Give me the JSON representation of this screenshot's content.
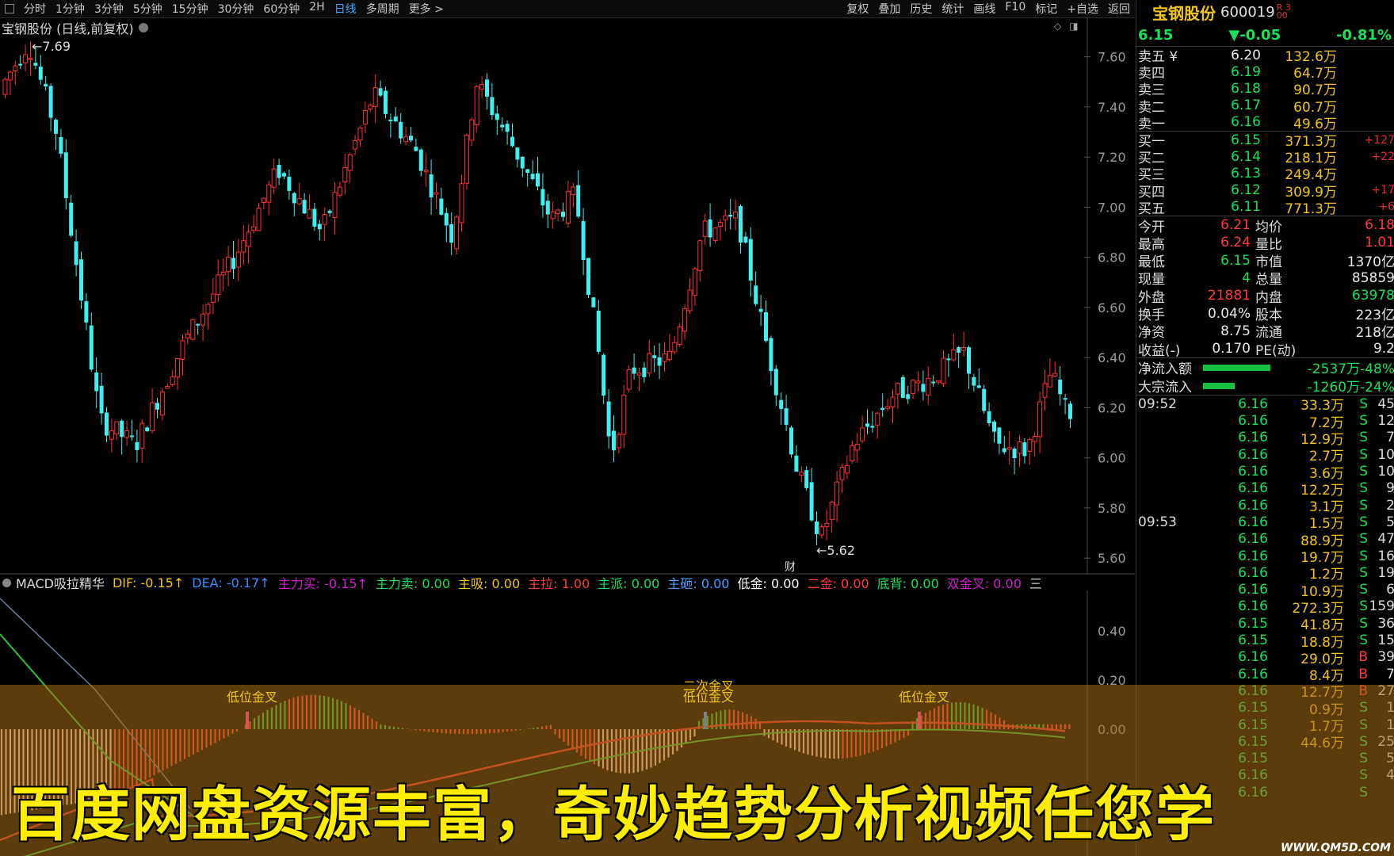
{
  "toolbar": {
    "periods": [
      "分时",
      "1分钟",
      "3分钟",
      "5分钟",
      "15分钟",
      "30分钟",
      "60分钟",
      "2H",
      "日线",
      "多周期",
      "更多 >"
    ],
    "active": "日线",
    "tools": [
      "复权",
      "叠加",
      "历史",
      "统计",
      "画线",
      "F10",
      "标记",
      "+自选",
      "返回"
    ]
  },
  "chart_header": {
    "title": "宝钢股份 (日线,前复权)"
  },
  "price_chart": {
    "high_label": "7.69",
    "low_label": "5.62",
    "marker_cai": "财",
    "axis_ticks": [
      "7.60",
      "7.40",
      "7.20",
      "7.00",
      "6.80",
      "6.60",
      "6.40",
      "6.20",
      "6.00",
      "5.80",
      "5.60"
    ],
    "colors": {
      "up": "#ff3030",
      "down": "#40f0f0"
    }
  },
  "macd_header": [
    {
      "t": "MACD吸拉精华",
      "c": "#dcdcdc"
    },
    {
      "t": "DIF: -0.15↑",
      "c": "#f0c419"
    },
    {
      "t": "DEA: -0.17↑",
      "c": "#3090ff"
    },
    {
      "t": "主力买: -0.15↑",
      "c": "#d020d0"
    },
    {
      "t": "主力卖: 0.00",
      "c": "#18e05a"
    },
    {
      "t": "主吸: 0.00",
      "c": "#f0c419"
    },
    {
      "t": "主拉: 1.00",
      "c": "#ff3b3b"
    },
    {
      "t": "主派: 0.00",
      "c": "#18e05a"
    },
    {
      "t": "主砸: 0.00",
      "c": "#40a0ff"
    },
    {
      "t": "低金: 0.00",
      "c": "#ffffff"
    },
    {
      "t": "二金: 0.00",
      "c": "#ff3b3b"
    },
    {
      "t": "底背: 0.00",
      "c": "#18e05a"
    },
    {
      "t": "双金叉: 0.00",
      "c": "#d020d0"
    }
  ],
  "macd_axis": [
    "0.40",
    "0.20",
    "0.00"
  ],
  "signals": {
    "low1": "低位金叉",
    "second": "二次金叉",
    "low2": "低位金叉",
    "low3": "低位金叉"
  },
  "quote": {
    "name": "宝钢股份",
    "code": "600019",
    "tag": "R 300",
    "price": "6.15",
    "change": "▼-0.05",
    "pct": "-0.81%",
    "asks": [
      {
        "l": "卖五 ¥",
        "p": "6.20",
        "v": "132.6万",
        "x": ""
      },
      {
        "l": "卖四",
        "p": "6.19",
        "v": "64.7万",
        "x": ""
      },
      {
        "l": "卖三",
        "p": "6.18",
        "v": "90.7万",
        "x": ""
      },
      {
        "l": "卖二",
        "p": "6.17",
        "v": "60.7万",
        "x": ""
      },
      {
        "l": "卖一",
        "p": "6.16",
        "v": "49.6万",
        "x": ""
      }
    ],
    "bids": [
      {
        "l": "买一",
        "p": "6.15",
        "v": "371.3万",
        "x": "+127"
      },
      {
        "l": "买二",
        "p": "6.14",
        "v": "218.1万",
        "x": "+22"
      },
      {
        "l": "买三",
        "p": "6.13",
        "v": "249.4万",
        "x": ""
      },
      {
        "l": "买四",
        "p": "6.12",
        "v": "309.9万",
        "x": "+17"
      },
      {
        "l": "买五",
        "p": "6.11",
        "v": "771.3万",
        "x": "+6"
      }
    ],
    "info": [
      {
        "l": "今开",
        "v": "6.21",
        "vc": "r",
        "l2": "均价",
        "v2": "6.18",
        "v2c": "r"
      },
      {
        "l": "最高",
        "v": "6.24",
        "vc": "r",
        "l2": "量比",
        "v2": "1.01",
        "v2c": "r"
      },
      {
        "l": "最低",
        "v": "6.15",
        "vc": "g",
        "l2": "市值",
        "v2": "1370亿",
        "v2c": "w"
      },
      {
        "l": "现量",
        "v": "4",
        "vc": "g",
        "l2": "总量",
        "v2": "85859",
        "v2c": "w"
      },
      {
        "l": "外盘",
        "v": "21881",
        "vc": "r",
        "l2": "内盘",
        "v2": "63978",
        "v2c": "g"
      },
      {
        "l": "换手",
        "v": "0.04%",
        "vc": "w",
        "l2": "股本",
        "v2": "223亿",
        "v2c": "w"
      },
      {
        "l": "净资",
        "v": "8.75",
        "vc": "w",
        "l2": "流通",
        "v2": "218亿",
        "v2c": "w"
      },
      {
        "l": "收益(-)",
        "v": "0.170",
        "vc": "w",
        "l2": "PE(动)",
        "v2": "9.2",
        "v2c": "w"
      }
    ],
    "flows": [
      {
        "l": "净流入额",
        "w": 85,
        "v": "-2537万-48%"
      },
      {
        "l": "大宗流入",
        "w": 40,
        "v": "-1260万-24%"
      }
    ],
    "ticks": [
      {
        "t": "09:52",
        "p": "6.16",
        "v": "33.3万",
        "bs": "S",
        "n": "45"
      },
      {
        "t": "",
        "p": "6.16",
        "v": "7.2万",
        "bs": "S",
        "n": "12"
      },
      {
        "t": "",
        "p": "6.16",
        "v": "12.9万",
        "bs": "S",
        "n": "7"
      },
      {
        "t": "",
        "p": "6.16",
        "v": "2.7万",
        "bs": "S",
        "n": "10"
      },
      {
        "t": "",
        "p": "6.16",
        "v": "3.6万",
        "bs": "S",
        "n": "10"
      },
      {
        "t": "",
        "p": "6.16",
        "v": "12.2万",
        "bs": "S",
        "n": "9"
      },
      {
        "t": "",
        "p": "6.16",
        "v": "3.1万",
        "bs": "S",
        "n": "2"
      },
      {
        "t": "09:53",
        "p": "6.16",
        "v": "1.5万",
        "bs": "S",
        "n": "5"
      },
      {
        "t": "",
        "p": "6.16",
        "v": "88.9万",
        "bs": "S",
        "n": "47"
      },
      {
        "t": "",
        "p": "6.16",
        "v": "19.7万",
        "bs": "S",
        "n": "16"
      },
      {
        "t": "",
        "p": "6.16",
        "v": "1.2万",
        "bs": "S",
        "n": "19"
      },
      {
        "t": "",
        "p": "6.16",
        "v": "10.9万",
        "bs": "S",
        "n": "6"
      },
      {
        "t": "",
        "p": "6.16",
        "v": "272.3万",
        "bs": "S",
        "n": "159",
        "vm": true
      },
      {
        "t": "",
        "p": "6.15",
        "v": "41.8万",
        "bs": "S",
        "n": "36"
      },
      {
        "t": "",
        "p": "6.15",
        "v": "18.8万",
        "bs": "S",
        "n": "15"
      },
      {
        "t": "",
        "p": "6.16",
        "v": "29.0万",
        "bs": "B",
        "n": "39"
      },
      {
        "t": "",
        "p": "6.16",
        "v": "8.4万",
        "bs": "B",
        "n": "7"
      },
      {
        "t": "",
        "p": "6.16",
        "v": "12.7万",
        "bs": "B",
        "n": "27"
      },
      {
        "t": "",
        "p": "6.15",
        "v": "0.9万",
        "bs": "S",
        "n": "1"
      },
      {
        "t": "",
        "p": "6.15",
        "v": "1.7万",
        "bs": "S",
        "n": "1"
      },
      {
        "t": "",
        "p": "6.15",
        "v": "44.6万",
        "bs": "S",
        "n": "25"
      },
      {
        "t": "",
        "p": "6.15",
        "v": "",
        "bs": "S",
        "n": "5"
      },
      {
        "t": "",
        "p": "6.16",
        "v": "",
        "bs": "S",
        "n": "4"
      },
      {
        "t": "",
        "p": "6.16",
        "v": "",
        "bs": "S",
        "n": ""
      }
    ]
  },
  "overlay": {
    "slogan": "百度网盘资源丰富，奇妙趋势分析视频任您学",
    "watermark": "WWW.QM5D.COM"
  }
}
